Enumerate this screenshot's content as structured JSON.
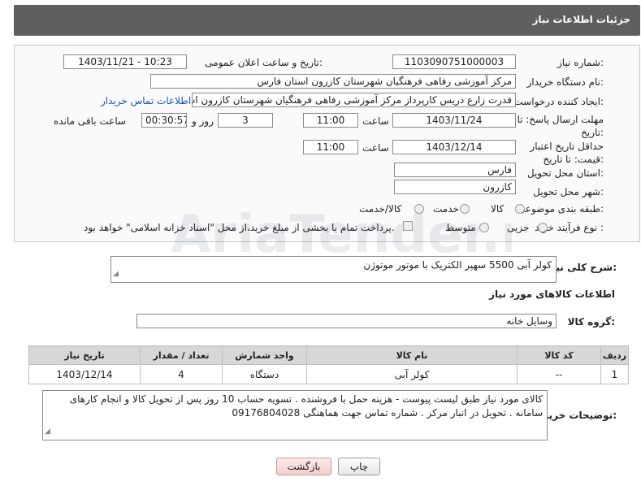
{
  "header": {
    "title": "جزئیات اطلاعات نیاز"
  },
  "form": {
    "need_number_label": "شماره نیاز:",
    "need_number": "1103090751000003",
    "announce_label": "تاریخ و ساعت اعلان عمومی:",
    "announce_value": "1403/11/21 - 10:23",
    "buyer_org_label": "نام دستگاه خریدار:",
    "buyer_org": "مرکز آموزشی رفاهی فرهنگیان شهرستان کازرون استان فارس",
    "requester_label": "ایجاد کننده درخواست:",
    "requester": "قدرت زارع دریس کارپرداز مرکز آموزشی رفاهی فرهنگیان شهرستان کازرون استان فارس",
    "contact_link": "اطلاعات تماس خریدار",
    "reply_deadline_label": "مهلت ارسال پاسخ: تا تاریخ:",
    "reply_date": "1403/11/24",
    "time_label": "ساعت",
    "reply_time": "11:00",
    "days_value": "3",
    "days_label": "روز و",
    "remaining_time": "00:30:57",
    "remaining_label": "ساعت باقی مانده",
    "price_validity_label": "حداقل تاریخ اعتبار قیمت: تا تاریخ:",
    "price_date": "1403/12/14",
    "price_time": "11:00",
    "province_label": "استان محل تحویل:",
    "province": "فارس",
    "city_label": "شهر محل تحویل:",
    "city": "کازرون",
    "category_label": "طبقه بندی موضوعی:",
    "category_options": [
      "کالا",
      "خدمت",
      "کالا/خدمت"
    ],
    "process_label": "نوع فرآیند خرید :",
    "process_options": [
      "جزیی",
      "متوسط"
    ],
    "payment_note": "پرداخت تمام یا بخشی از مبلغ خرید،از محل \"اسناد خزانه اسلامی\" خواهد بود."
  },
  "description": {
    "label": "شرح کلی نیاز:",
    "value": "کولر آبی 5500 سهپر الکتریک با موتور موتوژن"
  },
  "goods": {
    "section_title": "اطلاعات کالاهای مورد نیاز",
    "group_label": "گروه کالا:",
    "group_value": "وسایل خانه",
    "columns": [
      "ردیف",
      "کد کالا",
      "نام کالا",
      "واحد شمارش",
      "تعداد / مقدار",
      "تاریخ نیاز"
    ],
    "rows": [
      [
        "1",
        "--",
        "کولر آبی",
        "دستگاه",
        "4",
        "1403/12/14"
      ]
    ]
  },
  "buyer_notes": {
    "label": "توضیحات خریدار:",
    "value": "کالای مورد نیاز طبق لیست پیوست - هزینه حمل با فروشنده . تسویه حساب 10 روز پس از تحویل کالا و انجام کارهای سامانه . تحویل در انبار مرکز . شماره تماس جهت هماهنگی 09176804028"
  },
  "buttons": {
    "print": "چاپ",
    "back": "بازگشت"
  },
  "watermark": {
    "text": "AriaTender.net"
  }
}
